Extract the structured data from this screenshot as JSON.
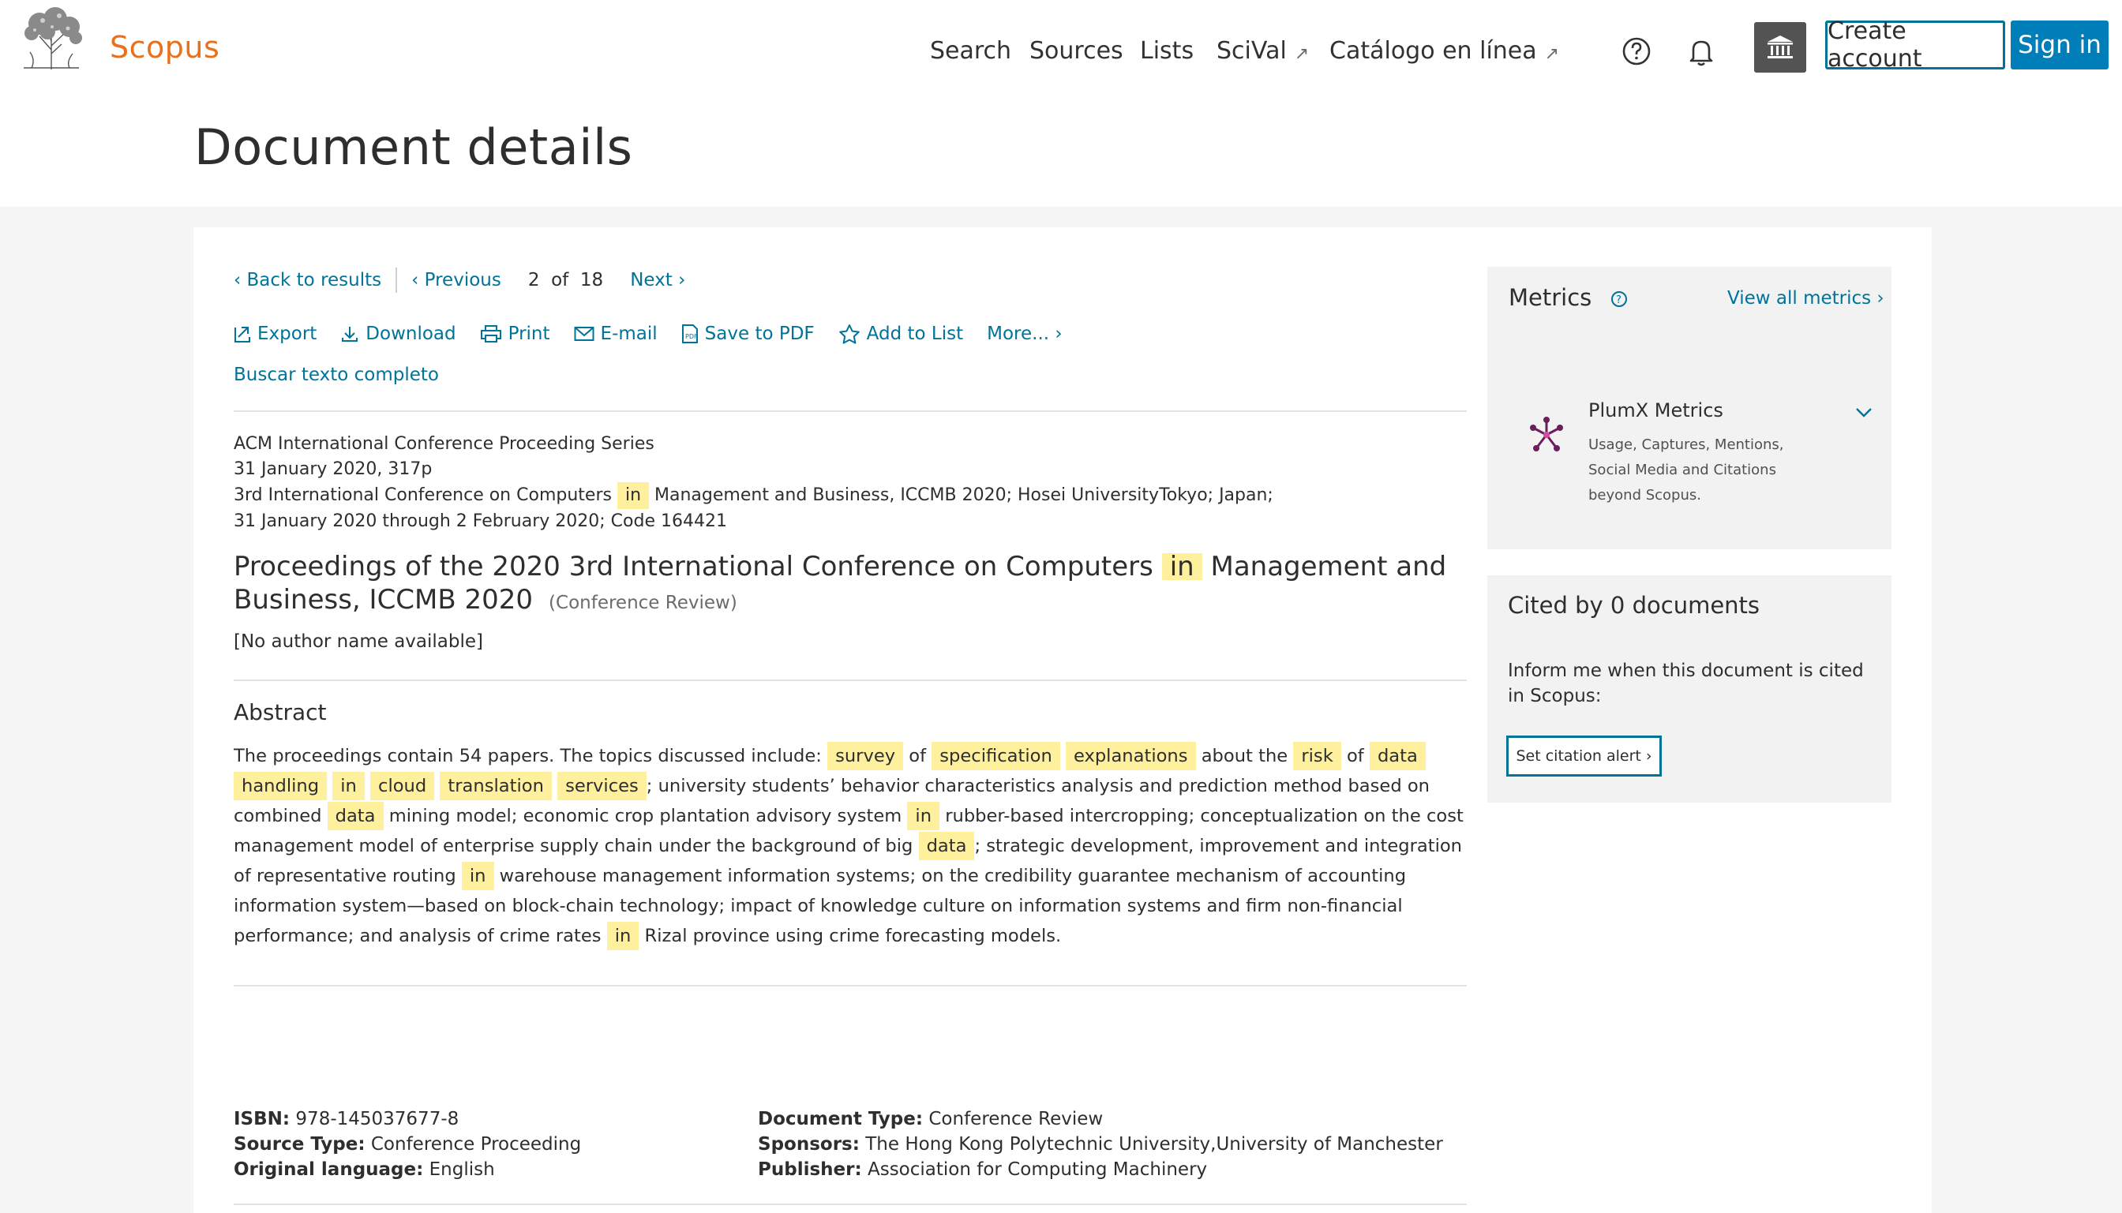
{
  "header": {
    "logo_text": "Scopus",
    "nav": [
      {
        "label": "Search",
        "external": false
      },
      {
        "label": "Sources",
        "external": false
      },
      {
        "label": "Lists",
        "external": false
      },
      {
        "label": "SciVal",
        "external": true
      },
      {
        "label": "Catálogo en línea",
        "external": true
      }
    ],
    "external_glyph": "↗",
    "create_account": "Create account",
    "sign_in": "Sign in",
    "icons": [
      "help-icon",
      "bell-icon",
      "institution-icon"
    ]
  },
  "page_title": "Document details",
  "navigation": {
    "back": "Back to results",
    "previous": "Previous",
    "current": "2",
    "of": "of",
    "total": "18",
    "next": "Next"
  },
  "actions": {
    "export": "Export",
    "download": "Download",
    "print": "Print",
    "email": "E-mail",
    "save_pdf": "Save to PDF",
    "add_list": "Add to List",
    "more": "More..."
  },
  "full_text": "Buscar texto completo",
  "source": {
    "series": "ACM International Conference Proceeding Series",
    "date_pages": "31 January 2020, 317p",
    "conference_pre": "3rd International Conference on Computers",
    "conference_hl": "in",
    "conference_post": "Management and Business, ICCMB 2020; Hosei UniversityTokyo; Japan;",
    "dates_code": "31 January 2020 through 2 February 2020; Code 164421"
  },
  "document": {
    "title_pre": "Proceedings of the 2020 3rd International Conference on Computers",
    "title_hl": "in",
    "title_post": "Management and Business, ICCMB 2020",
    "doc_type": "(Conference Review)",
    "authors": "[No author name available]"
  },
  "abstract": {
    "heading": "Abstract",
    "segments": [
      {
        "t": "The proceedings contain 54 papers. The topics discussed include: ",
        "h": false
      },
      {
        "t": "survey",
        "h": true
      },
      {
        "t": " of ",
        "h": false
      },
      {
        "t": "specification",
        "h": true
      },
      {
        "t": " ",
        "h": false
      },
      {
        "t": "explanations",
        "h": true
      },
      {
        "t": " about the ",
        "h": false
      },
      {
        "t": "risk",
        "h": true
      },
      {
        "t": " of ",
        "h": false
      },
      {
        "t": "data",
        "h": true
      },
      {
        "t": " ",
        "h": false
      },
      {
        "t": "handling",
        "h": true
      },
      {
        "t": " ",
        "h": false
      },
      {
        "t": "in",
        "h": true
      },
      {
        "t": " ",
        "h": false
      },
      {
        "t": "cloud",
        "h": true
      },
      {
        "t": " ",
        "h": false
      },
      {
        "t": "translation",
        "h": true
      },
      {
        "t": " ",
        "h": false
      },
      {
        "t": "services",
        "h": true
      },
      {
        "t": "; university students’ behavior characteristics analysis and prediction method based on combined ",
        "h": false
      },
      {
        "t": "data",
        "h": true
      },
      {
        "t": " mining model; economic crop plantation advisory system ",
        "h": false
      },
      {
        "t": "in",
        "h": true
      },
      {
        "t": " rubber-based intercropping; conceptualization on the cost management model of enterprise supply chain under the background of big ",
        "h": false
      },
      {
        "t": "data",
        "h": true
      },
      {
        "t": "; strategic development, improvement and integration of representative routing ",
        "h": false
      },
      {
        "t": "in",
        "h": true
      },
      {
        "t": " warehouse management information systems; on the credibility guarantee mechanism of accounting information system—based on block-chain technology; impact of knowledge culture on information systems and firm non-financial performance; and analysis of crime rates ",
        "h": false
      },
      {
        "t": "in",
        "h": true
      },
      {
        "t": " Rizal province using crime forecasting models.",
        "h": false
      }
    ]
  },
  "details": {
    "isbn_label": "ISBN:",
    "isbn": "978-145037677-8",
    "source_type_label": "Source Type:",
    "source_type": "Conference Proceeding",
    "language_label": "Original language:",
    "language": "English",
    "doc_type_label": "Document Type:",
    "doc_type": "Conference Review",
    "sponsors_label": "Sponsors:",
    "sponsors": "The Hong Kong Polytechnic University,University of Manchester",
    "publisher_label": "Publisher:",
    "publisher": "Association for Computing Machinery"
  },
  "metrics": {
    "title": "Metrics",
    "view_all": "View all metrics",
    "plumx_title": "PlumX Metrics",
    "plumx_desc": "Usage, Captures, Mentions, Social Media and Citations beyond Scopus."
  },
  "cited": {
    "title": "Cited by 0 documents",
    "text": "Inform me when this document is cited in Scopus:",
    "alert_button": "Set citation alert"
  },
  "colors": {
    "accent": "#007398",
    "brand": "#e9711c",
    "highlight": "#fff09e",
    "signin": "#007eb9"
  }
}
